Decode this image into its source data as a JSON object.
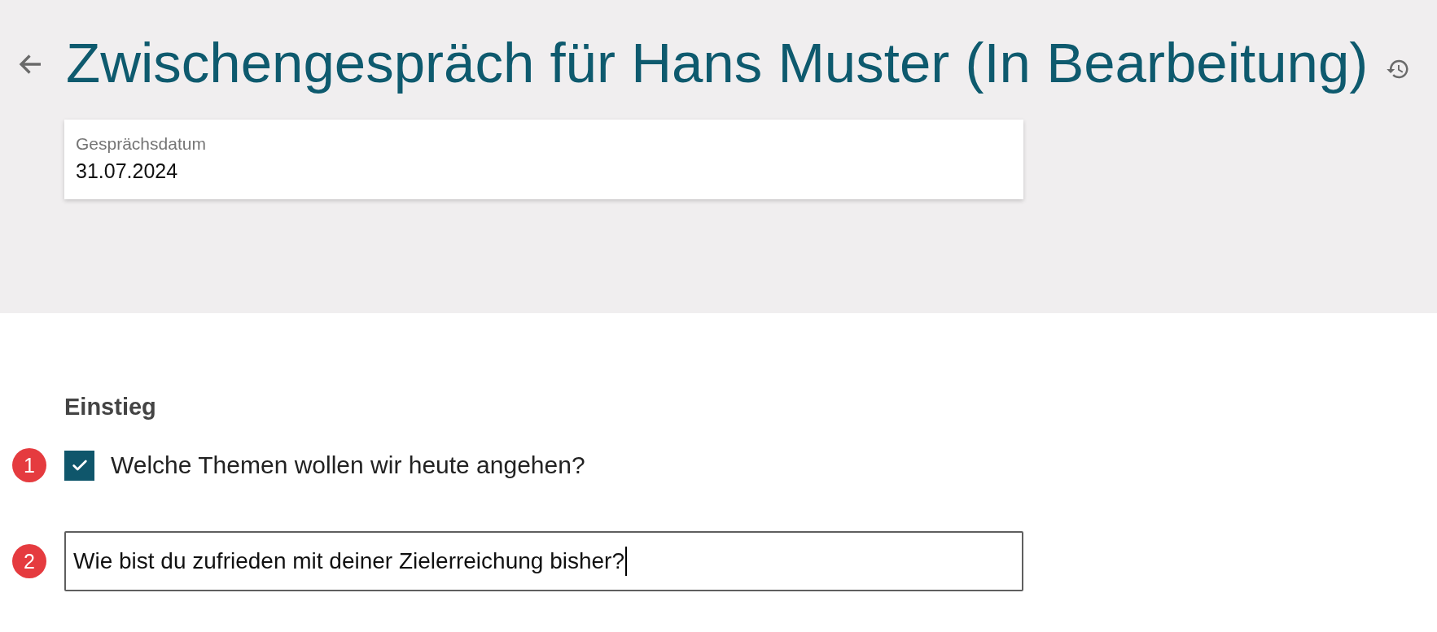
{
  "header": {
    "title": "Zwischengespräch für Hans Muster (In Bearbeitung)"
  },
  "date_field": {
    "label": "Gesprächsdatum",
    "value": "31.07.2024"
  },
  "section": {
    "title": "Einstieg",
    "items": [
      {
        "kind": "checkbox",
        "marker": "1",
        "label": "Welche Themen wollen wir heute angehen?",
        "checked": true
      },
      {
        "kind": "text_input",
        "marker": "2",
        "value": "Wie bist du zufrieden mit deiner Zielerreichung bisher?",
        "focused": true
      }
    ]
  }
}
